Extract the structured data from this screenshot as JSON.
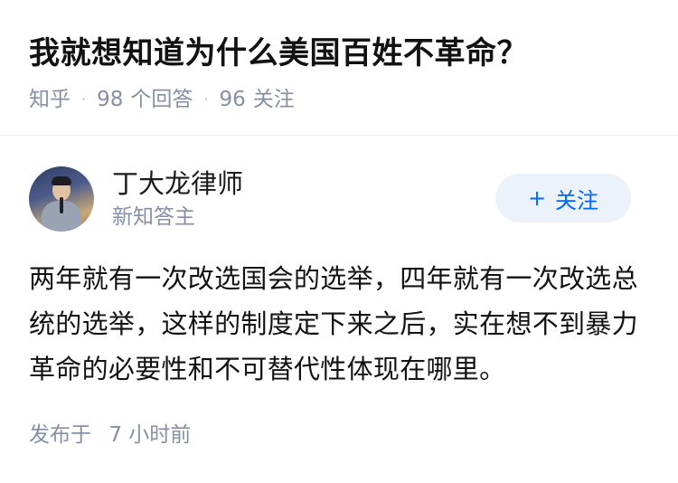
{
  "question": {
    "title": "我就想知道为什么美国百姓不革命？",
    "source": "知乎",
    "answer_count": "98",
    "answer_label": "个回答",
    "follower_count": "96",
    "follower_label": "关注",
    "separator": "·"
  },
  "answer": {
    "author_name": "丁大龙律师",
    "author_badge": "新知答主",
    "follow_label": "关注",
    "follow_icon": "+",
    "content": "两年就有一次改选国会的选举，四年就有一次改选总统的选举，这样的制度定下来之后，实在想不到暴力革命的必要性和不可替代性体现在哪里。",
    "published_label": "发布于",
    "published_time": "7 小时前"
  },
  "colors": {
    "title": "#121212",
    "meta": "#8590a6",
    "follow_bg": "#ebf2fa",
    "follow_text": "#0066ff"
  }
}
